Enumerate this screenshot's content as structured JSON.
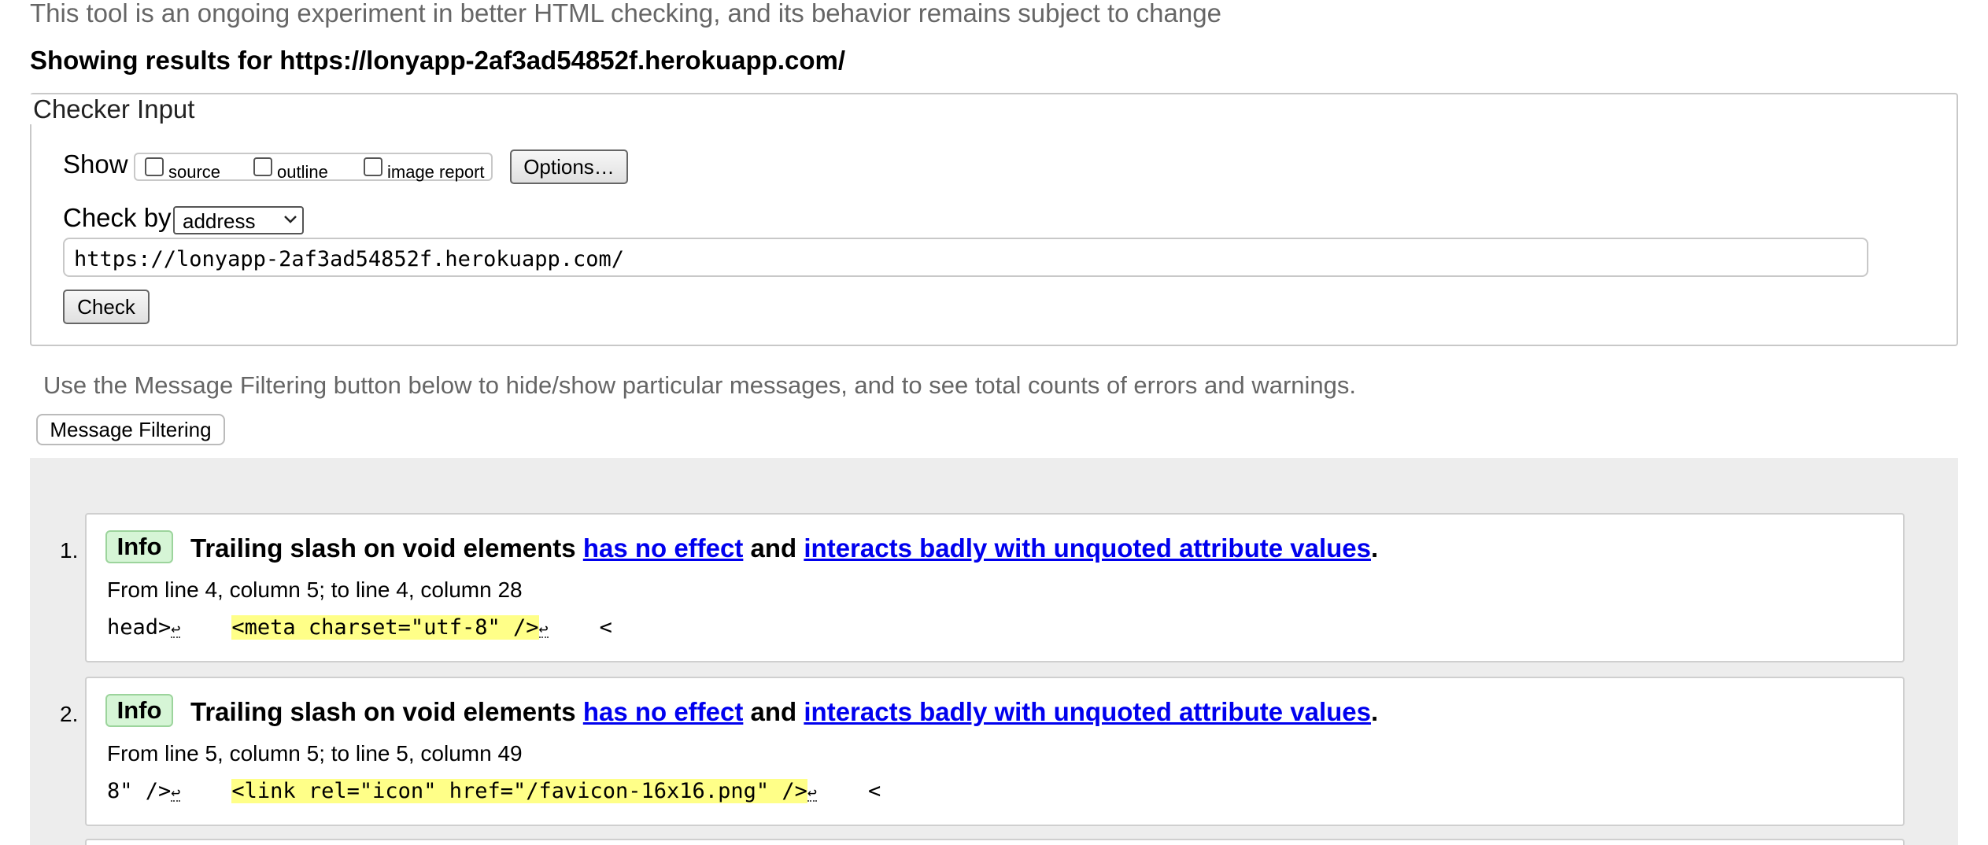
{
  "intro_text": "This tool is an ongoing experiment in better HTML checking, and its behavior remains subject to change",
  "results_title": "Showing results for https://lonyapp-2af3ad54852f.herokuapp.com/",
  "checker": {
    "legend": "Checker Input",
    "show_label": "Show",
    "options": [
      {
        "label": "source",
        "checked": false
      },
      {
        "label": "outline",
        "checked": false
      },
      {
        "label": "image report",
        "checked": false
      }
    ],
    "options_button": "Options…",
    "check_by_label": "Check by",
    "check_by_value": "address",
    "url_value": "https://lonyapp-2af3ad54852f.herokuapp.com/",
    "check_button": "Check"
  },
  "filter_note": "Use the Message Filtering button below to hide/show particular messages, and to see total counts of errors and warnings.",
  "filter_button": "Message Filtering",
  "messages": [
    {
      "number": "1.",
      "type": "Info",
      "title_prefix": "Trailing slash on void elements ",
      "link1": "has no effect",
      "title_mid": " and ",
      "link2": "interacts badly with unquoted attribute values",
      "title_suffix": ".",
      "location": "From line 4, column 5; to line 4, column 28",
      "extract_before": "head>",
      "extract_highlight": "<meta charset=\"utf-8\" />",
      "extract_after": "<"
    },
    {
      "number": "2.",
      "type": "Info",
      "title_prefix": "Trailing slash on void elements ",
      "link1": "has no effect",
      "title_mid": " and ",
      "link2": "interacts badly with unquoted attribute values",
      "title_suffix": ".",
      "location": "From line 5, column 5; to line 5, column 49",
      "extract_before": "8\" />",
      "extract_highlight": "<link rel=\"icon\" href=\"/favicon-16x16.png\" />",
      "extract_after": "<"
    }
  ],
  "return_glyph": "↩",
  "colors": {
    "info_badge_bg": "#d6f5d6",
    "highlight": "#ffff88",
    "link": "#0000ee",
    "results_bg": "#ededed"
  }
}
